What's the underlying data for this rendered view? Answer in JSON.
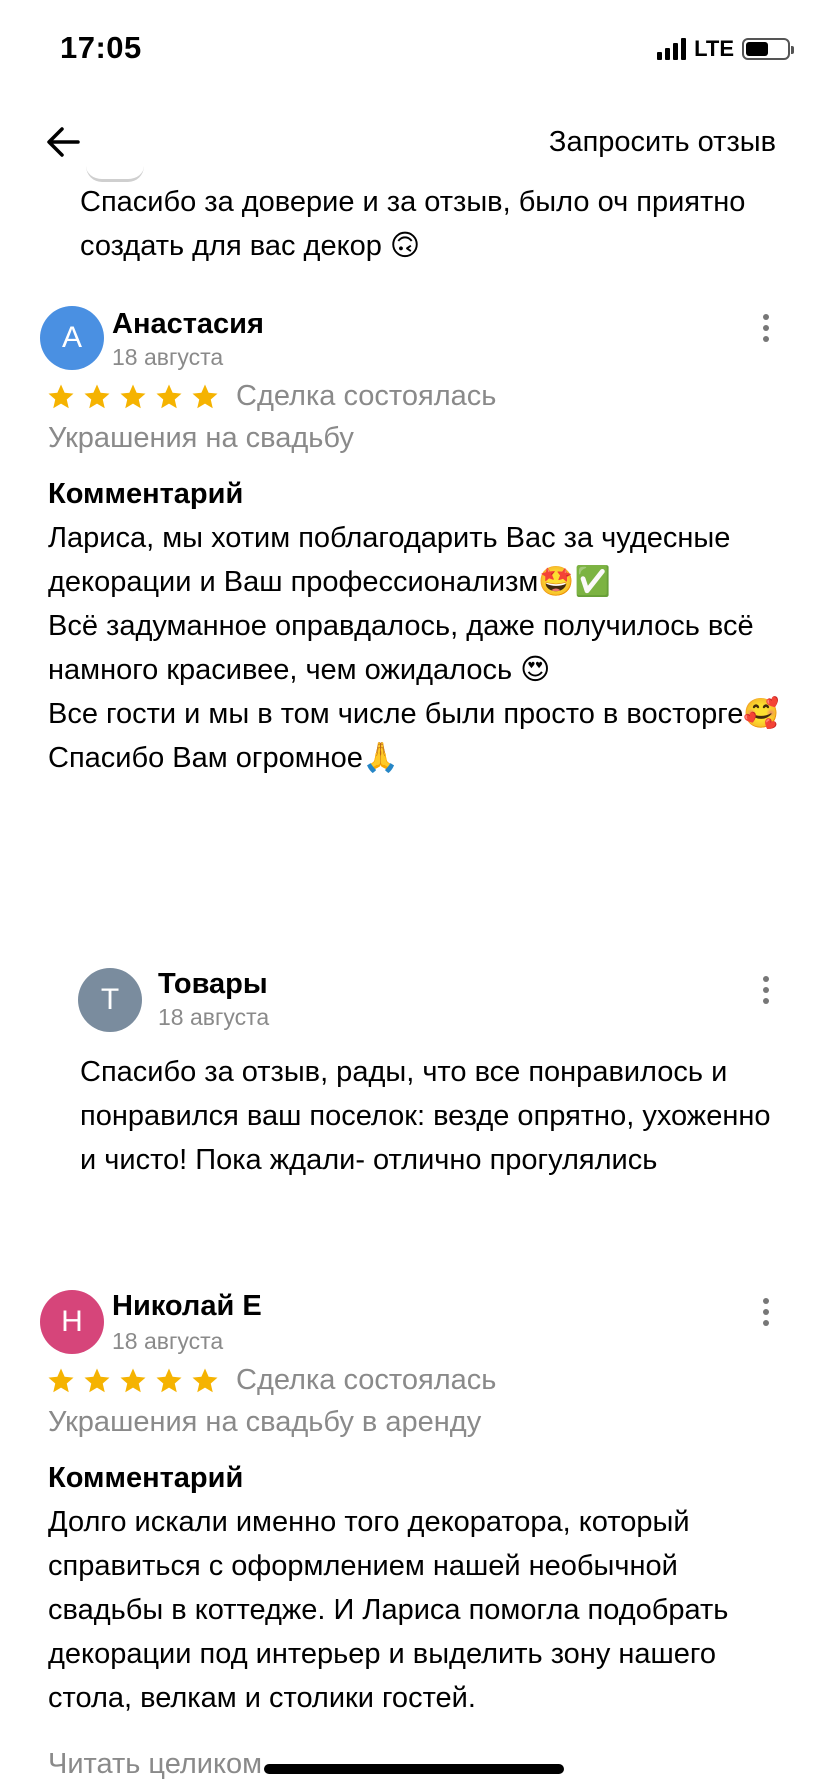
{
  "status_bar": {
    "time": "17:05",
    "network": "LTE"
  },
  "header": {
    "request_review": "Запросить отзыв"
  },
  "top_reply": {
    "text": "Спасибо за доверие и за отзыв, было оч приятно создать для вас декор 🙃"
  },
  "reviews": [
    {
      "initial": "А",
      "avatar_color": "#4a90e2",
      "name": "Анастасия",
      "date": "18 августа",
      "rating": 5,
      "deal_status": "Сделка состоялась",
      "category": "Украшения на свадьбу",
      "comment_heading": "Комментарий",
      "comment": "Лариса, мы хотим поблагодарить Вас за чудесные декорации и Ваш профессионализм🤩✅\nВсё задуманное оправдалось, даже получилось всё намного красивее, чем ожидалось 😍\nВсе гости и мы в том числе были просто в восторге🥰\nСпасибо Вам огромное🙏",
      "reply": {
        "initial": "Т",
        "avatar_color": "#7a8c9e",
        "name": "Товары",
        "date": "18 августа",
        "text": "Спасибо за отзыв, рады, что все понравилось и понравился ваш поселок: везде опрятно, ухоженно и чисто! Пока ждали- отлично прогулялись"
      }
    },
    {
      "initial": "Н",
      "avatar_color": "#d6457a",
      "name": "Николай Е",
      "date": "18 августа",
      "rating": 5,
      "deal_status": "Сделка состоялась",
      "category": "Украшения на свадьбу в аренду",
      "comment_heading": "Комментарий",
      "comment": "Долго  искали именно того декоратора, который справиться с оформлением нашей необычной свадьбы в коттедже. И Лариса помогла подобрать декорации под интерьер и выделить зону нашего стола, велкам и столики гостей.",
      "read_more": "Читать целиком"
    }
  ],
  "colors": {
    "star": "#f5b301",
    "muted": "#8a8a8a"
  },
  "icons": {
    "back": "arrow-left-icon",
    "more": "kebab-icon",
    "star": "star-icon"
  }
}
